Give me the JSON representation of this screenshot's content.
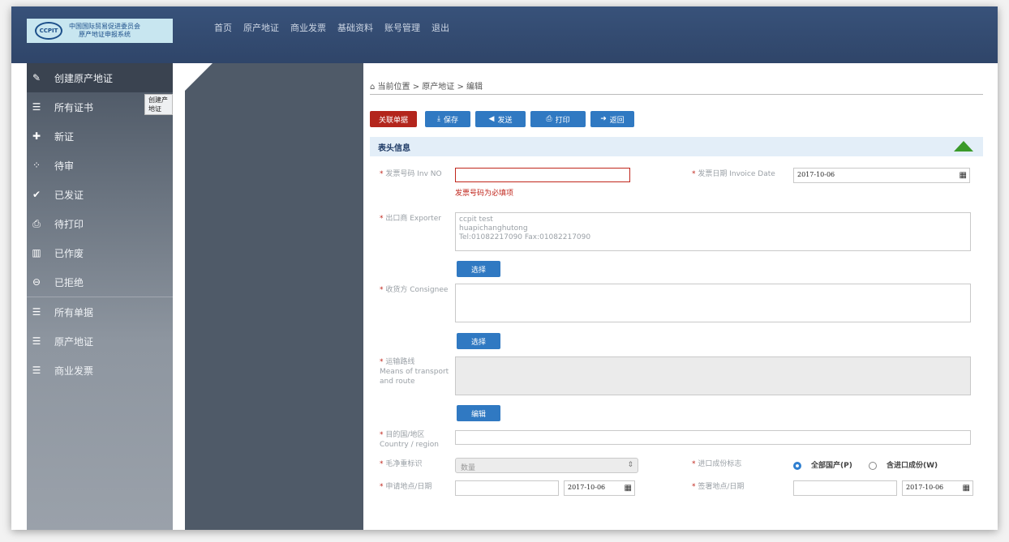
{
  "logo": {
    "emblem": "CCPIT",
    "line1": "中国国际贸易促进委员会",
    "line2": "原产地证申报系统"
  },
  "nav": [
    "首页",
    "原产地证",
    "商业发票",
    "基础资料",
    "账号管理",
    "退出"
  ],
  "sidebar": {
    "items": [
      {
        "label": "创建原产地证",
        "icon": "pencil-icon"
      },
      {
        "label": "所有证书",
        "icon": "list-icon"
      },
      {
        "label": "新证",
        "icon": "plus-icon"
      },
      {
        "label": "待审",
        "icon": "spinner-icon"
      },
      {
        "label": "已发证",
        "icon": "check-circle-icon"
      },
      {
        "label": "待打印",
        "icon": "printer-icon"
      },
      {
        "label": "已作废",
        "icon": "trash-icon"
      },
      {
        "label": "已拒绝",
        "icon": "minus-circle-icon"
      },
      {
        "label": "所有单据",
        "icon": "list-icon"
      },
      {
        "label": "原产地证",
        "icon": "list-icon"
      },
      {
        "label": "商业发票",
        "icon": "list-icon"
      }
    ],
    "tooltip": "创建产地证"
  },
  "breadcrumb": "当前位置 > 原产地证 > 编辑",
  "toolbar": {
    "related": "关联单据",
    "save": "保存",
    "send": "发送",
    "print": "打印",
    "back": "返回"
  },
  "section_title": "表头信息",
  "form": {
    "inv_no_label": "发票号码 Inv NO",
    "inv_no_value": "",
    "inv_no_error": "发票号码为必填项",
    "invoice_date_label": "发票日期 Invoice Date",
    "invoice_date_value": "2017-10-06",
    "exporter_label": "出口商 Exporter",
    "exporter_line1": "ccpit test",
    "exporter_line2": "huapichanghutong",
    "exporter_line3": "Tel:01082217090       Fax:01082217090",
    "select_label": "选择",
    "consignee_label": "收货方 Consignee",
    "transport_label_1": "运输路线",
    "transport_label_2": "Means of transport",
    "transport_label_3": "and route",
    "edit_label": "编辑",
    "country_label_1": "目的国/地区",
    "country_label_2": "Country / region",
    "weight_label": "毛净重标识",
    "weight_value": "数量",
    "import_label": "进口成份标志",
    "radio_all": "全部国产(P)",
    "radio_import": "含进口成份(W)",
    "apply_label": "申请地点/日期",
    "apply_date": "2017-10-06",
    "sign_label": "签署地点/日期",
    "sign_date": "2017-10-06"
  },
  "colors": {
    "topbar": "#2f4569",
    "required": "#c0261c",
    "button_blue": "#3079c2",
    "button_red": "#b3251c"
  }
}
